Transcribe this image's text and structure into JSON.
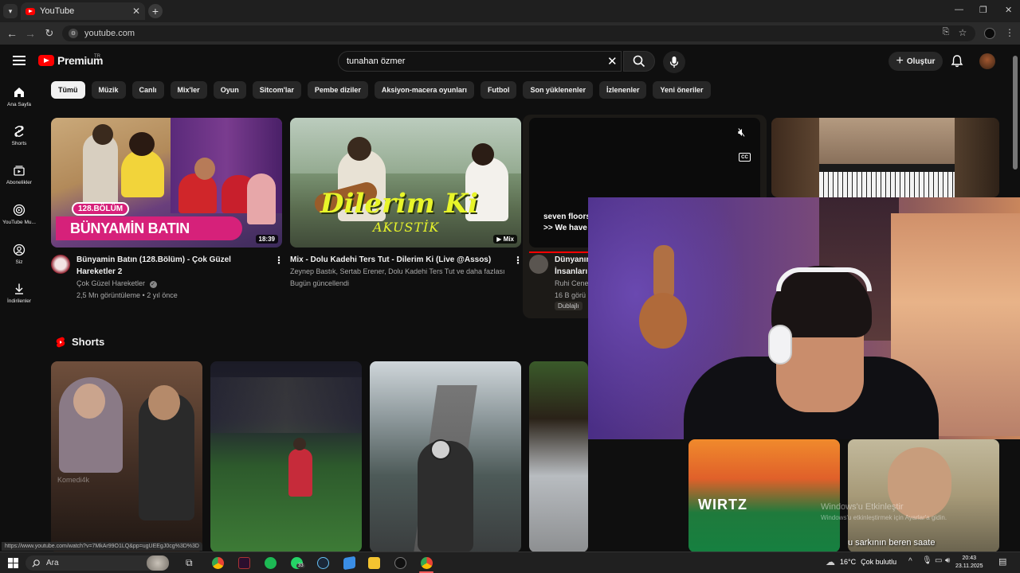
{
  "browser": {
    "tab_title": "YouTube",
    "tab_close": "✕",
    "new_tab": "+",
    "url": "youtube.com",
    "window_controls": [
      "—",
      "❐",
      "✕"
    ]
  },
  "masthead": {
    "logo_word": "Premium",
    "region": "TR",
    "search_value": "tunahan özmer",
    "create_label": "Oluştur"
  },
  "guide": [
    {
      "label": "Ana Sayfa",
      "icon": "home-icon"
    },
    {
      "label": "Shorts",
      "icon": "shorts-icon"
    },
    {
      "label": "Abonelikler",
      "icon": "subscriptions-icon"
    },
    {
      "label": "YouTube Mu...",
      "icon": "music-icon"
    },
    {
      "label": "Siz",
      "icon": "you-icon"
    },
    {
      "label": "İndirilenler",
      "icon": "download-icon"
    }
  ],
  "chips": [
    "Tümü",
    "Müzik",
    "Canlı",
    "Mix'ler",
    "Oyun",
    "Sitcom'lar",
    "Pembe diziler",
    "Aksiyon-macera oyunları",
    "Futbol",
    "Son yüklenenler",
    "İzlenenler",
    "Yeni öneriler"
  ],
  "videos": [
    {
      "badge": "128.BÖLÜM",
      "overlay": "BÜNYAMİN BATIN",
      "duration": "18:39",
      "title_line1": "Bünyamin Batın (128.Bölüm) - Çok Güzel",
      "title_line2": "Hareketler 2",
      "channel": "Çok Güzel Hareketler",
      "stats": "2,5 Mn görüntüleme • 2 yıl önce"
    },
    {
      "overlay": "Dilerim Ki",
      "overlay_sub": "AKUSTİK",
      "duration": "Mix",
      "title_line1": "Mix - Dolu Kadehi Ters Tut - Dilerim Ki (Live @Assos)",
      "channel": "Zeynep Bastık, Sertab Erener, Dolu Kadehi Ters Tut ve daha fazlası",
      "stats": "Bugün güncellendi"
    },
    {
      "caption1": "seven floors",
      "caption2": ">> We have",
      "title_line1": "Dünyanın",
      "title_line2": "İnsanları",
      "channel": "Ruhi Cene",
      "stats": "16 B görü",
      "badge2": "Dublajlı"
    }
  ],
  "shorts": {
    "header": "Shorts",
    "items": [
      {
        "watermark": "Komedi4k"
      },
      {},
      {},
      {},
      {
        "text": "WIRTZ"
      },
      {
        "caption": "u sarkının beren saate"
      }
    ]
  },
  "status_url": "https://www.youtube.com/watch?v=7MkAr99O1LQ&pp=ugUEEgJ0cg%3D%3D",
  "watermark": {
    "line1": "Windows'u Etkinleştir",
    "line2": "Windows'u etkinleştirmek için Ayarlar'a gidin."
  },
  "taskbar": {
    "search_label": "Ara",
    "badge": "33",
    "temperature": "16°C",
    "weather": "Çok bulutlu",
    "time": "20:43",
    "date": "23.11.2025"
  },
  "colors": {
    "brand": "#ff0000",
    "bg": "#0f0f0f",
    "chip": "#272727"
  }
}
